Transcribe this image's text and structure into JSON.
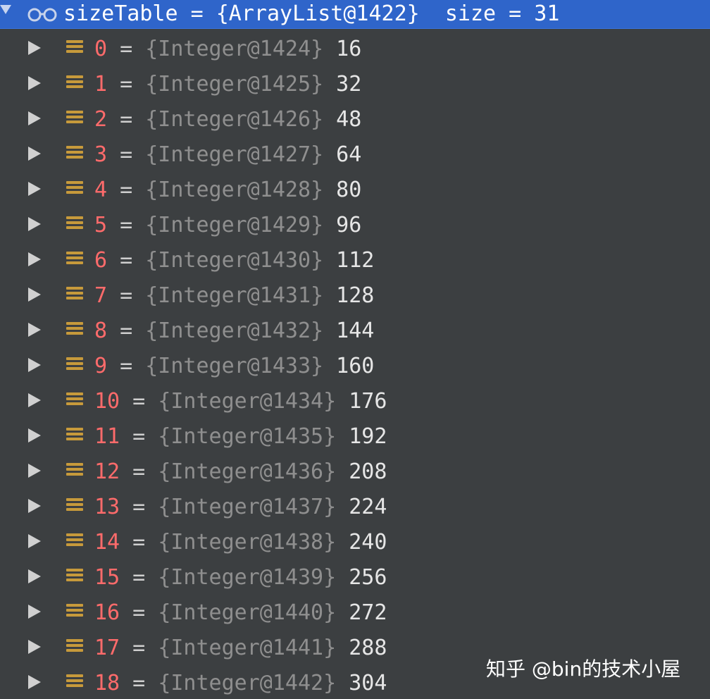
{
  "header": {
    "title": "sizeTable = {ArrayList@1422}  size = 31"
  },
  "icons": {
    "toggle": "chevron-down-icon",
    "watch": "glasses-icon",
    "row_toggle": "chevron-right-icon",
    "field": "field-icon"
  },
  "colors": {
    "header_bg": "#2f65ca",
    "panel_bg": "#3c3f41",
    "index": "#ff6b6b",
    "ref": "#8f8f8f",
    "value": "#e6e6e6",
    "field_icon": "#c79a3b"
  },
  "rows": [
    {
      "index": "0",
      "eq": " = ",
      "ref": "{Integer@1424}",
      "value": " 16"
    },
    {
      "index": "1",
      "eq": " = ",
      "ref": "{Integer@1425}",
      "value": " 32"
    },
    {
      "index": "2",
      "eq": " = ",
      "ref": "{Integer@1426}",
      "value": " 48"
    },
    {
      "index": "3",
      "eq": " = ",
      "ref": "{Integer@1427}",
      "value": " 64"
    },
    {
      "index": "4",
      "eq": " = ",
      "ref": "{Integer@1428}",
      "value": " 80"
    },
    {
      "index": "5",
      "eq": " = ",
      "ref": "{Integer@1429}",
      "value": " 96"
    },
    {
      "index": "6",
      "eq": " = ",
      "ref": "{Integer@1430}",
      "value": " 112"
    },
    {
      "index": "7",
      "eq": " = ",
      "ref": "{Integer@1431}",
      "value": " 128"
    },
    {
      "index": "8",
      "eq": " = ",
      "ref": "{Integer@1432}",
      "value": " 144"
    },
    {
      "index": "9",
      "eq": " = ",
      "ref": "{Integer@1433}",
      "value": " 160"
    },
    {
      "index": "10",
      "eq": " = ",
      "ref": "{Integer@1434}",
      "value": " 176"
    },
    {
      "index": "11",
      "eq": " = ",
      "ref": "{Integer@1435}",
      "value": " 192"
    },
    {
      "index": "12",
      "eq": " = ",
      "ref": "{Integer@1436}",
      "value": " 208"
    },
    {
      "index": "13",
      "eq": " = ",
      "ref": "{Integer@1437}",
      "value": " 224"
    },
    {
      "index": "14",
      "eq": " = ",
      "ref": "{Integer@1438}",
      "value": " 240"
    },
    {
      "index": "15",
      "eq": " = ",
      "ref": "{Integer@1439}",
      "value": " 256"
    },
    {
      "index": "16",
      "eq": " = ",
      "ref": "{Integer@1440}",
      "value": " 272"
    },
    {
      "index": "17",
      "eq": " = ",
      "ref": "{Integer@1441}",
      "value": " 288"
    },
    {
      "index": "18",
      "eq": " = ",
      "ref": "{Integer@1442}",
      "value": " 304"
    }
  ],
  "watermark": "知乎 @bin的技术小屋"
}
